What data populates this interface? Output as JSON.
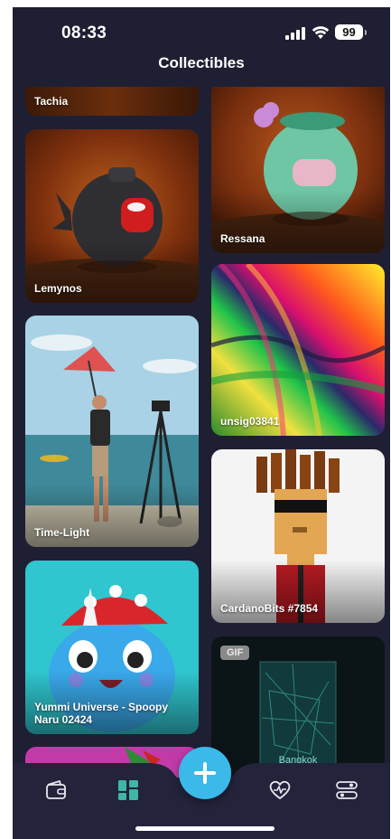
{
  "status_bar": {
    "time": "08:33",
    "battery": "99"
  },
  "header": {
    "title": "Collectibles"
  },
  "collectibles": [
    {
      "name": "Tachia"
    },
    {
      "name": "Ressana"
    },
    {
      "name": "Lemynos"
    },
    {
      "name": "unsig03841"
    },
    {
      "name": "Time-Light"
    },
    {
      "name": "CardanoBits #7854"
    },
    {
      "name": "Yummi Universe - Spoopy Naru 02424"
    },
    {
      "name": "Bangkok",
      "badge": "GIF"
    }
  ],
  "tabbar": {
    "items": [
      {
        "icon": "wallet-icon"
      },
      {
        "icon": "grid-icon",
        "active": true
      },
      {
        "icon": "plus-icon"
      },
      {
        "icon": "heart-pulse-icon"
      },
      {
        "icon": "settings-toggle-icon"
      }
    ]
  },
  "colors": {
    "background": "#1f1f33",
    "accent": "#3bb9e8",
    "active_tab": "#3fb6a8"
  }
}
